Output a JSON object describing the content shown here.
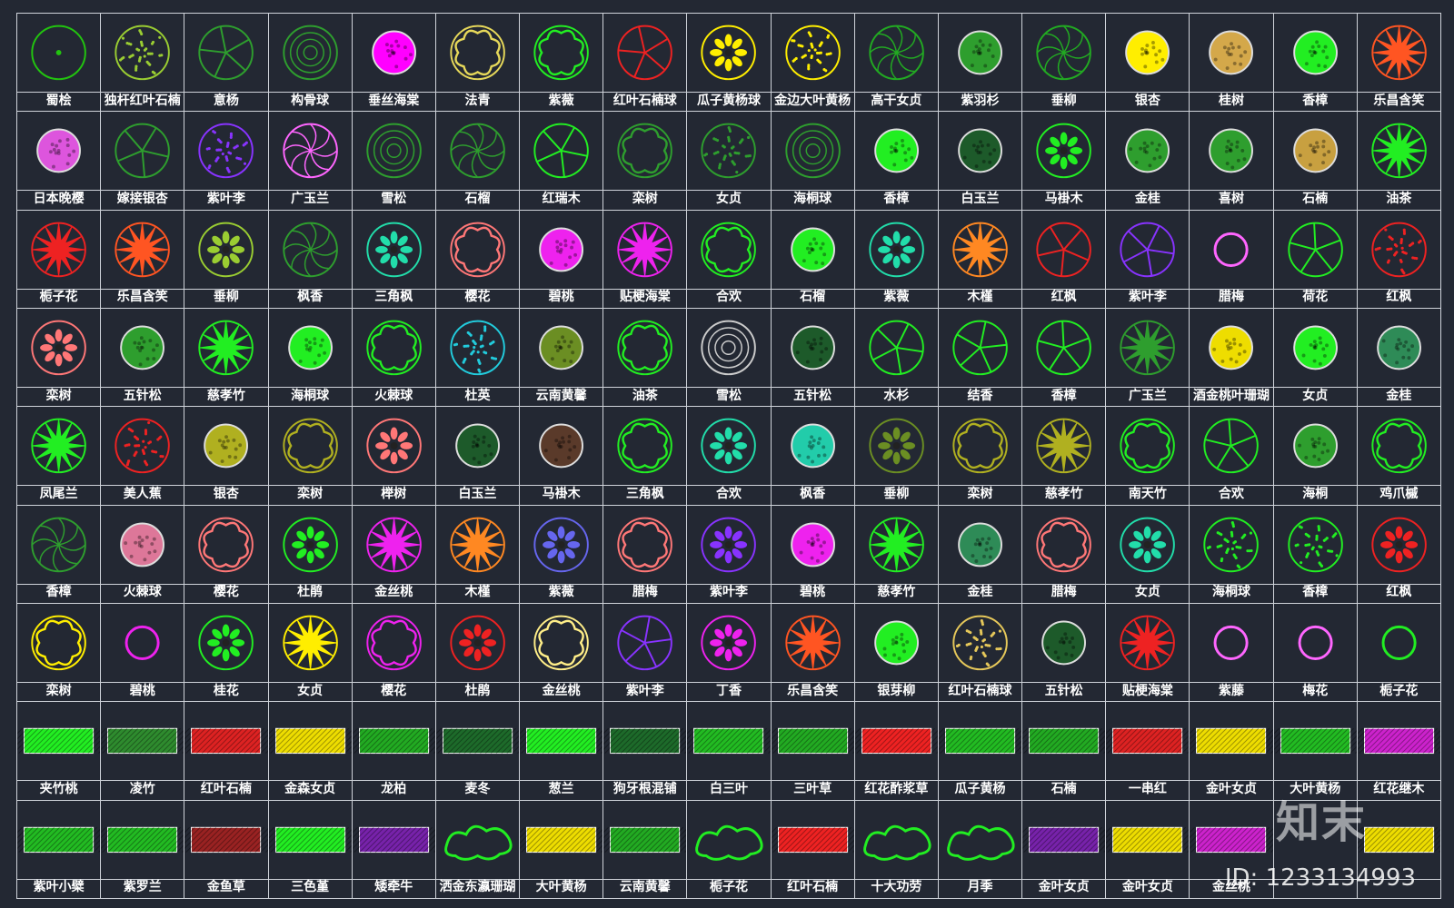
{
  "rows": [
    [
      [
        "蜀桧",
        "#22c40f",
        "tree1"
      ],
      [
        "独杆红叶石楠",
        "#9acd32",
        "dots"
      ],
      [
        "意杨",
        "#2e9e2e",
        "branch"
      ],
      [
        "构骨球",
        "#2e9e2e",
        "rings"
      ],
      [
        "垂丝海棠",
        "#ff00ff",
        "fill"
      ],
      [
        "法青",
        "#e6d85a",
        "cloud"
      ],
      [
        "紫薇",
        "#22ee22",
        "cloud"
      ],
      [
        "红叶石楠球",
        "#ee2222",
        "branch"
      ],
      [
        "瓜子黄杨球",
        "#ffee00",
        "flower"
      ],
      [
        "金边大叶黄杨",
        "#ffee00",
        "dots"
      ],
      [
        "高干女贞",
        "#22aa22",
        "spiral"
      ],
      [
        "紫羽杉",
        "#2e9e2e",
        "fill"
      ],
      [
        "垂柳",
        "#22aa22",
        "spiral"
      ],
      [
        "银杏",
        "#ffee00",
        "fill"
      ],
      [
        "桂树",
        "#d4a84a",
        "fill"
      ],
      [
        "香樟",
        "#22ee22",
        "fill"
      ],
      [
        "乐昌含笑",
        "#ff5522",
        "star"
      ]
    ],
    [
      [
        "日本晚樱",
        "#dd55dd",
        "fill"
      ],
      [
        "嫁接银杏",
        "#2e9e2e",
        "branch"
      ],
      [
        "紫叶李",
        "#8833ff",
        "dots"
      ],
      [
        "广玉兰",
        "#ff66ff",
        "spiral"
      ],
      [
        "雪松",
        "#2e9e2e",
        "rings"
      ],
      [
        "石榴",
        "#2e9e2e",
        "spiral"
      ],
      [
        "红瑞木",
        "#22ee22",
        "branch"
      ],
      [
        "栾树",
        "#2e9e2e",
        "cloud"
      ],
      [
        "女贞",
        "#2e9e2e",
        "dots"
      ],
      [
        "海桐球",
        "#2e9e2e",
        "rings"
      ],
      [
        "香樟",
        "#22ee22",
        "fill"
      ],
      [
        "白玉兰",
        "#1d5a2a",
        "fill"
      ],
      [
        "马褂木",
        "#22ee22",
        "flower"
      ],
      [
        "金桂",
        "#2e9e2e",
        "fill"
      ],
      [
        "喜树",
        "#2e9e2e",
        "fill"
      ],
      [
        "石楠",
        "#c8a040",
        "fill"
      ],
      [
        "油茶",
        "#22ee22",
        "star"
      ]
    ],
    [
      [
        "栀子花",
        "#ee2222",
        "star"
      ],
      [
        "乐昌含笑",
        "#ff5522",
        "star"
      ],
      [
        "垂柳",
        "#9acd32",
        "flower"
      ],
      [
        "枫香",
        "#2e9e2e",
        "spiral"
      ],
      [
        "三角枫",
        "#22ddaa",
        "flower"
      ],
      [
        "樱花",
        "#ff7777",
        "cloud"
      ],
      [
        "碧桃",
        "#ee22ee",
        "fill"
      ],
      [
        "贴梗海棠",
        "#ee22ee",
        "star"
      ],
      [
        "合欢",
        "#22ee22",
        "cloud"
      ],
      [
        "石榴",
        "#22ee22",
        "fill"
      ],
      [
        "紫薇",
        "#22ddaa",
        "flower"
      ],
      [
        "木槿",
        "#ff8822",
        "star"
      ],
      [
        "红枫",
        "#ee2222",
        "branch"
      ],
      [
        "紫叶李",
        "#8833ff",
        "branch"
      ],
      [
        "腊梅",
        "#ff66ff",
        "ring"
      ],
      [
        "荷花",
        "#22ee22",
        "branch"
      ],
      [
        "红枫",
        "#ee2222",
        "dots"
      ]
    ],
    [
      [
        "栾树",
        "#ff7777",
        "flower"
      ],
      [
        "五针松",
        "#2e9e2e",
        "fill"
      ],
      [
        "慈孝竹",
        "#22ee22",
        "star"
      ],
      [
        "海桐球",
        "#22ee22",
        "fill"
      ],
      [
        "火棘球",
        "#22ee22",
        "cloud"
      ],
      [
        "杜英",
        "#22ccdd",
        "dots"
      ],
      [
        "云南黄馨",
        "#6b8e23",
        "fill"
      ],
      [
        "油茶",
        "#22ee22",
        "cloud"
      ],
      [
        "雪松",
        "#cccccc",
        "rings"
      ],
      [
        "五针松",
        "#1d5a2a",
        "fill"
      ],
      [
        "水杉",
        "#22ee22",
        "branch"
      ],
      [
        "结香",
        "#22ee22",
        "branch"
      ],
      [
        "香樟",
        "#22ee22",
        "branch"
      ],
      [
        "广玉兰",
        "#2e9e2e",
        "star"
      ],
      [
        "酒金桃叶珊瑚",
        "#eedd00",
        "fill"
      ],
      [
        "女贞",
        "#22ee22",
        "fill"
      ],
      [
        "金桂",
        "#2e8b57",
        "fill"
      ]
    ],
    [
      [
        "凤尾兰",
        "#22ee22",
        "star"
      ],
      [
        "美人蕉",
        "#ee2222",
        "dots"
      ],
      [
        "银杏",
        "#b0b020",
        "fill"
      ],
      [
        "栾树",
        "#b0b020",
        "cloud"
      ],
      [
        "榉树",
        "#ff7777",
        "flower"
      ],
      [
        "白玉兰",
        "#1d5a2a",
        "fill"
      ],
      [
        "马褂木",
        "#5a3a2a",
        "fill"
      ],
      [
        "三角枫",
        "#22ee22",
        "cloud"
      ],
      [
        "合欢",
        "#22ddaa",
        "flower"
      ],
      [
        "枫香",
        "#22ccaa",
        "fill"
      ],
      [
        "垂柳",
        "#6b8e23",
        "flower"
      ],
      [
        "栾树",
        "#b0b020",
        "cloud"
      ],
      [
        "慈孝竹",
        "#b0b020",
        "star"
      ],
      [
        "南天竹",
        "#22ee22",
        "cloud"
      ],
      [
        "合欢",
        "#22ee22",
        "branch"
      ],
      [
        "海桐",
        "#2e9e2e",
        "fill"
      ],
      [
        "鸡爪槭",
        "#22ee22",
        "cloud"
      ]
    ],
    [
      [
        "香樟",
        "#2e9e2e",
        "spiral"
      ],
      [
        "火棘球",
        "#dd7799",
        "fill"
      ],
      [
        "樱花",
        "#ff7777",
        "cloud"
      ],
      [
        "杜鹃",
        "#22ee22",
        "flower"
      ],
      [
        "金丝桃",
        "#ee22ee",
        "star"
      ],
      [
        "木槿",
        "#ff8822",
        "star"
      ],
      [
        "紫薇",
        "#6666ee",
        "flower"
      ],
      [
        "腊梅",
        "#ff7777",
        "cloud"
      ],
      [
        "紫叶李",
        "#8833ff",
        "flower"
      ],
      [
        "碧桃",
        "#ee22ee",
        "fill"
      ],
      [
        "慈孝竹",
        "#22ee22",
        "star"
      ],
      [
        "金桂",
        "#2e8b57",
        "fill"
      ],
      [
        "腊梅",
        "#ff7777",
        "cloud"
      ],
      [
        "女贞",
        "#22ddaa",
        "flower"
      ],
      [
        "海桐球",
        "#22ee22",
        "dots"
      ],
      [
        "香樟",
        "#22ee22",
        "dots"
      ],
      [
        "红枫",
        "#ee2222",
        "flower"
      ]
    ],
    [
      [
        "栾树",
        "#ffee00",
        "cloud"
      ],
      [
        "碧桃",
        "#ee22ee",
        "ring"
      ],
      [
        "桂花",
        "#22ee22",
        "flower"
      ],
      [
        "女贞",
        "#ffee00",
        "star"
      ],
      [
        "樱花",
        "#ee22ee",
        "cloud"
      ],
      [
        "杜鹃",
        "#ee2222",
        "flower"
      ],
      [
        "金丝桃",
        "#ffee88",
        "cloud"
      ],
      [
        "紫叶李",
        "#8833ff",
        "branch"
      ],
      [
        "丁香",
        "#ee22ee",
        "flower"
      ],
      [
        "乐昌含笑",
        "#ff5522",
        "star"
      ],
      [
        "银芽柳",
        "#22ee22",
        "fill"
      ],
      [
        "红叶石楠球",
        "#e6c85a",
        "dots"
      ],
      [
        "五针松",
        "#1d5a2a",
        "fill"
      ],
      [
        "贴梗海棠",
        "#ee2222",
        "star"
      ],
      [
        "紫藤",
        "#ff66ff",
        "ring"
      ],
      [
        "梅花",
        "#ff66ff",
        "ring"
      ],
      [
        "栀子花",
        "#22ee22",
        "ring"
      ]
    ],
    [
      [
        "夹竹桃",
        "#22ee22",
        "hatch"
      ],
      [
        "凌竹",
        "#2e8b2e",
        "hatch"
      ],
      [
        "红叶石楠",
        "#dd2222",
        "hatch"
      ],
      [
        "金森女贞",
        "#eedd00",
        "hatch"
      ],
      [
        "龙柏",
        "#22aa22",
        "hatch"
      ],
      [
        "麦冬",
        "#1d6a2a",
        "hatch"
      ],
      [
        "葱兰",
        "#22ee22",
        "hatch"
      ],
      [
        "狗牙根混铺",
        "#1d6a2a",
        "hatch"
      ],
      [
        "白三叶",
        "#22bb22",
        "hatch"
      ],
      [
        "三叶草",
        "#22aa22",
        "hatch"
      ],
      [
        "红花酢浆草",
        "#ee2222",
        "hatch"
      ],
      [
        "瓜子黄杨",
        "#22bb22",
        "hatch"
      ],
      [
        "石楠",
        "#22aa22",
        "hatch"
      ],
      [
        "一串红",
        "#dd2222",
        "hatch"
      ],
      [
        "金叶女贞",
        "#eedd00",
        "hatch"
      ],
      [
        "大叶黄杨",
        "#22bb22",
        "hatch"
      ],
      [
        "红花继木",
        "#cc22cc",
        "hatch"
      ]
    ],
    [
      [
        "紫叶小檗",
        "#22bb22",
        "hatch"
      ],
      [
        "紫罗兰",
        "#22bb22",
        "hatch"
      ],
      [
        "金鱼草",
        "#992222",
        "hatch"
      ],
      [
        "三色堇",
        "#22ee22",
        "hatch"
      ],
      [
        "矮牵牛",
        "#7722aa",
        "hatch"
      ],
      [
        "洒金东瀛珊瑚",
        "#22ee22",
        "blob"
      ],
      [
        "大叶黄杨",
        "#eedd00",
        "hatch"
      ],
      [
        "云南黄馨",
        "#22aa22",
        "hatch"
      ],
      [
        "栀子花",
        "#22ee22",
        "blob"
      ],
      [
        "红叶石楠",
        "#ee2222",
        "hatch"
      ],
      [
        "十大功劳",
        "#22ee22",
        "blob"
      ],
      [
        "月季",
        "#22ee22",
        "blob"
      ],
      [
        "金叶女贞",
        "#7722aa",
        "hatch"
      ],
      [
        "金叶女贞",
        "#eedd00",
        "hatch"
      ],
      [
        "金丝桃",
        "#cc22cc",
        "hatch"
      ],
      [
        "",
        "#cccccc",
        "empty"
      ],
      [
        "",
        "#eedd00",
        "hatch"
      ]
    ]
  ],
  "watermark": {
    "logo": "知末",
    "id": "ID: 1233134993"
  }
}
